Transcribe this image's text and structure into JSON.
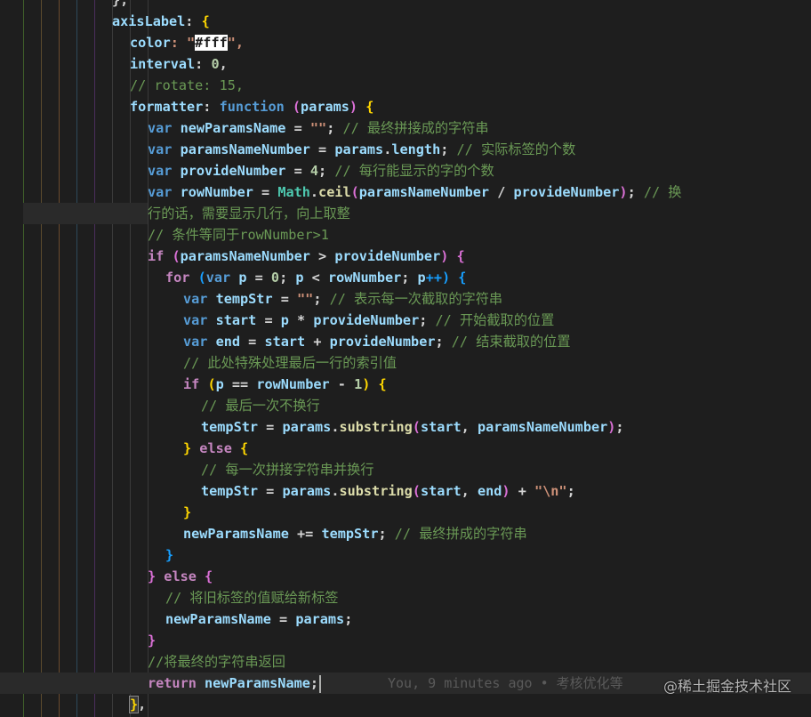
{
  "editor": {
    "colors": {
      "background": "#1e1e1e",
      "guide_colors": [
        "#3f5f2a",
        "#5b4a2e",
        "#6b4a2e",
        "#2e4a5b",
        "#4a2e5b",
        "#5b2e4a",
        "#2e5b4a",
        "#4a5b2e"
      ]
    },
    "lines": [
      {
        "t1": "}",
        "t2": ","
      },
      {
        "t1": "axisLabel",
        "t2": ": ",
        "t3": "{"
      },
      {
        "t1": "color",
        "t2": ": \"",
        "t3": "#fff",
        "t4": "\","
      },
      {
        "t1": "interval",
        "t2": ": ",
        "t3": "0",
        "t4": ","
      },
      {
        "t1": "// rotate: 15,"
      },
      {
        "t1": "formatter",
        "t2": ": ",
        "t3": "function",
        "t4": " (",
        "t5": "params",
        "t6": ") ",
        "t7": "{"
      },
      {
        "t1": "var",
        "t2": " newParamsName",
        "t3": " = ",
        "t4": "\"\"",
        "t5": "; ",
        "t6": "// 最终拼接成的字符串"
      },
      {
        "t1": "var",
        "t2": " paramsNameNumber",
        "t3": " = ",
        "t4": "params",
        "t5": ".",
        "t6": "length",
        "t7": "; ",
        "t8": "// 实际标签的个数"
      },
      {
        "t1": "var",
        "t2": " provideNumber",
        "t3": " = ",
        "t4": "4",
        "t5": "; ",
        "t6": "// 每行能显示的字的个数"
      },
      {
        "t1": "var",
        "t2": " rowNumber",
        "t3": " = ",
        "t4": "Math",
        "t5": ".",
        "t6": "ceil",
        "t7": "(",
        "t8": "paramsNameNumber",
        "t9": " / ",
        "t10": "provideNumber",
        "t11": ")",
        "t12": "; ",
        "t13": "// 换"
      },
      {
        "t1": "行的话，需要显示几行，向上取整"
      },
      {
        "t1": "// 条件等同于rowNumber>1"
      },
      {
        "t1": "if",
        "t2": " (",
        "t3": "paramsNameNumber",
        "t4": " > ",
        "t5": "provideNumber",
        "t6": ") ",
        "t7": "{"
      },
      {
        "t1": "for",
        "t2": " (",
        "t3": "var",
        "t4": " p",
        "t5": " = ",
        "t6": "0",
        "t7": "; ",
        "t8": "p",
        "t9": " < ",
        "t10": "rowNumber",
        "t11": "; ",
        "t12": "p",
        "t13": "++) ",
        "t14": "{"
      },
      {
        "t1": "var",
        "t2": " tempStr",
        "t3": " = ",
        "t4": "\"\"",
        "t5": "; ",
        "t6": "// 表示每一次截取的字符串"
      },
      {
        "t1": "var",
        "t2": " start",
        "t3": " = ",
        "t4": "p",
        "t5": " * ",
        "t6": "provideNumber",
        "t7": "; ",
        "t8": "// 开始截取的位置"
      },
      {
        "t1": "var",
        "t2": " end",
        "t3": " = ",
        "t4": "start",
        "t5": " + ",
        "t6": "provideNumber",
        "t7": "; ",
        "t8": "// 结束截取的位置"
      },
      {
        "t1": "// 此处特殊处理最后一行的索引值"
      },
      {
        "t1": "if",
        "t2": " (",
        "t3": "p",
        "t4": " == ",
        "t5": "rowNumber",
        "t6": " - ",
        "t7": "1",
        "t8": ") ",
        "t9": "{"
      },
      {
        "t1": "// 最后一次不换行"
      },
      {
        "t1": "tempStr",
        "t2": " = ",
        "t3": "params",
        "t4": ".",
        "t5": "substring",
        "t6": "(",
        "t7": "start",
        "t8": ", ",
        "t9": "paramsNameNumber",
        "t10": ")",
        "t11": ";"
      },
      {
        "t1": "}",
        "t2": " else ",
        "t3": "{"
      },
      {
        "t1": "// 每一次拼接字符串并换行"
      },
      {
        "t1": "tempStr",
        "t2": " = ",
        "t3": "params",
        "t4": ".",
        "t5": "substring",
        "t6": "(",
        "t7": "start",
        "t8": ", ",
        "t9": "end",
        "t10": ")",
        "t11": " + ",
        "t12": "\"\\n\"",
        "t13": ";"
      },
      {
        "t1": "}"
      },
      {
        "t1": "newParamsName",
        "t2": " += ",
        "t3": "tempStr",
        "t4": "; ",
        "t5": "// 最终拼成的字符串"
      },
      {
        "t1": "}"
      },
      {
        "t1": "}",
        "t2": " else ",
        "t3": "{"
      },
      {
        "t1": "// 将旧标签的值赋给新标签"
      },
      {
        "t1": "newParamsName",
        "t2": " = ",
        "t3": "params",
        "t4": ";"
      },
      {
        "t1": "}"
      },
      {
        "t1": "//将最终的字符串返回"
      },
      {
        "t1": "return",
        "t2": " newParamsName",
        "t3": ";"
      },
      {
        "t1": "}",
        "t2": ","
      }
    ],
    "blame": "You, 9 minutes ago • 考核优化等"
  },
  "watermark": "@稀土掘金技术社区"
}
